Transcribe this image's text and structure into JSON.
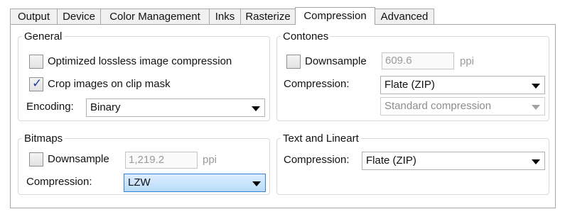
{
  "tabs": [
    {
      "label": "Output"
    },
    {
      "label": "Device"
    },
    {
      "label": "Color Management"
    },
    {
      "label": "Inks"
    },
    {
      "label": "Rasterize"
    },
    {
      "label": "Compression",
      "active": true
    },
    {
      "label": "Advanced"
    }
  ],
  "general": {
    "title": "General",
    "optimized_label": "Optimized lossless image compression",
    "optimized_checked": false,
    "crop_label": "Crop images on clip mask",
    "crop_checked": true,
    "encoding_label": "Encoding:",
    "encoding_value": "Binary"
  },
  "contones": {
    "title": "Contones",
    "downsample_label": "Downsample",
    "downsample_checked": false,
    "downsample_value": "609.6",
    "unit": "ppi",
    "compression_label": "Compression:",
    "compression_value": "Flate (ZIP)",
    "quality_value": "Standard compression"
  },
  "bitmaps": {
    "title": "Bitmaps",
    "downsample_label": "Downsample",
    "downsample_checked": false,
    "downsample_value": "1,219.2",
    "unit": "ppi",
    "compression_label": "Compression:",
    "compression_value": "LZW"
  },
  "text_lineart": {
    "title": "Text and Lineart",
    "compression_label": "Compression:",
    "compression_value": "Flate (ZIP)"
  }
}
